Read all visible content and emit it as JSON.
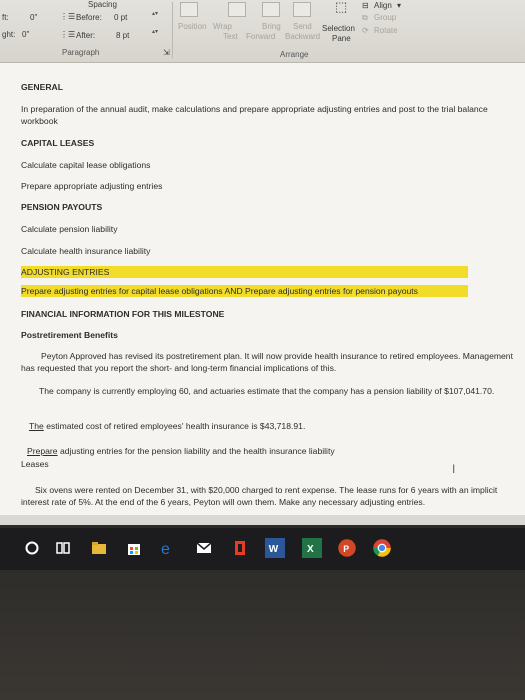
{
  "ribbon": {
    "spacing_label": "Spacing",
    "indent_left_label": "ft:",
    "indent_left_value": "0\"",
    "indent_right_label": "ght:",
    "indent_right_value": "0\"",
    "before_label": "Before:",
    "before_value": "0 pt",
    "after_label": "After:",
    "after_value": "8 pt",
    "paragraph_group": "Paragraph",
    "arrange_group": "Arrange",
    "position_label": "Position",
    "wrap_text_label": "Wrap",
    "wrap_text_label2": "Text",
    "bring_forward_label": "Bring",
    "bring_forward_label2": "Forward",
    "send_backward_label": "Send",
    "send_backward_label2": "Backward",
    "selection_pane_label": "Selection",
    "selection_pane_label2": "Pane",
    "align_label": "Align",
    "group_label": "Group",
    "rotate_label": "Rotate"
  },
  "document": {
    "general_heading": "GENERAL",
    "general_text": "In preparation of the annual audit, make calculations and prepare appropriate adjusting entries and post to the trial balance workbook",
    "capital_leases_heading": "CAPITAL LEASES",
    "capital_item1": "Calculate capital lease obligations",
    "capital_item2": "Prepare appropriate adjusting entries",
    "pension_heading": "PENSION PAYOUTS",
    "pension_item1": "Calculate pension liability",
    "pension_item2": "Calculate health insurance liability",
    "adjusting_heading": "ADJUSTING ENTRIES",
    "adjusting_text": "Prepare adjusting entries for capital lease obligations AND Prepare adjusting entries for pension payouts",
    "financial_heading": "FINANCIAL INFORMATION FOR THIS MILESTONE",
    "postretirement_heading": "Postretirement Benefits",
    "para1": "Peyton Approved has revised its postretirement plan. It will now provide health insurance to retired employees. Management has requested that you report the short- and long-term financial implications of this.",
    "para2": "The company is currently employing 60, and actuaries estimate that the company has a pension liability of $107,041.70.",
    "para3_prefix": "The",
    "para3_rest": " estimated cost of retired employees' health insurance is $43,718.91.",
    "para4_prefix": "Prepare",
    "para4_rest": " adjusting entries for the pension liability and the health insurance liability",
    "leases_label": "Leases",
    "para5": "Six ovens were rented on December 31, with $20,000 charged to rent expense. The lease runs for 6 years with an implicit interest rate of 5%. At the end of the 6 years, Peyton will own them. Make any necessary adjusting entries."
  },
  "taskbar": {
    "icons": [
      "start-icon",
      "task-view-icon",
      "file-explorer-icon",
      "store-icon",
      "edge-icon",
      "mail-icon",
      "office-icon",
      "word-icon",
      "excel-icon",
      "powerpoint-icon",
      "chrome-icon"
    ],
    "colors": {
      "highlight": "#f2dc2a",
      "word": "#2b579a",
      "excel": "#217346",
      "powerpoint": "#d24726",
      "edge": "#1e78d6"
    }
  }
}
